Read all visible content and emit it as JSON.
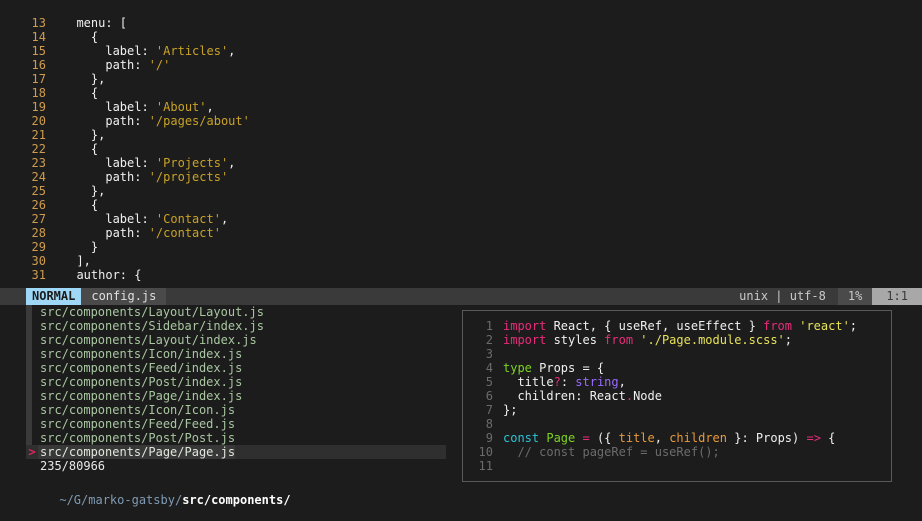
{
  "editor": {
    "lines": [
      {
        "num": "13",
        "segments": [
          {
            "t": "  menu: [",
            "c": "punc"
          }
        ]
      },
      {
        "num": "14",
        "segments": [
          {
            "t": "    {",
            "c": "punc"
          }
        ]
      },
      {
        "num": "15",
        "segments": [
          {
            "t": "      label: ",
            "c": "punc"
          },
          {
            "t": "'Articles'",
            "c": "str"
          },
          {
            "t": ",",
            "c": "punc"
          }
        ]
      },
      {
        "num": "16",
        "segments": [
          {
            "t": "      path: ",
            "c": "punc"
          },
          {
            "t": "'/'",
            "c": "str"
          }
        ]
      },
      {
        "num": "17",
        "segments": [
          {
            "t": "    },",
            "c": "punc"
          }
        ]
      },
      {
        "num": "18",
        "segments": [
          {
            "t": "    {",
            "c": "punc"
          }
        ]
      },
      {
        "num": "19",
        "segments": [
          {
            "t": "      label: ",
            "c": "punc"
          },
          {
            "t": "'About'",
            "c": "str"
          },
          {
            "t": ",",
            "c": "punc"
          }
        ]
      },
      {
        "num": "20",
        "segments": [
          {
            "t": "      path: ",
            "c": "punc"
          },
          {
            "t": "'/pages/about'",
            "c": "str"
          }
        ]
      },
      {
        "num": "21",
        "segments": [
          {
            "t": "    },",
            "c": "punc"
          }
        ]
      },
      {
        "num": "22",
        "segments": [
          {
            "t": "    {",
            "c": "punc"
          }
        ]
      },
      {
        "num": "23",
        "segments": [
          {
            "t": "      label: ",
            "c": "punc"
          },
          {
            "t": "'Projects'",
            "c": "str"
          },
          {
            "t": ",",
            "c": "punc"
          }
        ]
      },
      {
        "num": "24",
        "segments": [
          {
            "t": "      path: ",
            "c": "punc"
          },
          {
            "t": "'/projects'",
            "c": "str"
          }
        ]
      },
      {
        "num": "25",
        "segments": [
          {
            "t": "    },",
            "c": "punc"
          }
        ]
      },
      {
        "num": "26",
        "segments": [
          {
            "t": "    {",
            "c": "punc"
          }
        ]
      },
      {
        "num": "27",
        "segments": [
          {
            "t": "      label: ",
            "c": "punc"
          },
          {
            "t": "'Contact'",
            "c": "str"
          },
          {
            "t": ",",
            "c": "punc"
          }
        ]
      },
      {
        "num": "28",
        "segments": [
          {
            "t": "      path: ",
            "c": "punc"
          },
          {
            "t": "'/contact'",
            "c": "str"
          }
        ]
      },
      {
        "num": "29",
        "segments": [
          {
            "t": "    }",
            "c": "punc"
          }
        ]
      },
      {
        "num": "30",
        "segments": [
          {
            "t": "  ],",
            "c": "punc"
          }
        ]
      },
      {
        "num": "31",
        "segments": [
          {
            "t": "  author: {",
            "c": "punc"
          }
        ]
      }
    ]
  },
  "statusline": {
    "mode": "NORMAL",
    "filename": "config.js",
    "encoding": "unix | utf-8",
    "percent": "1%",
    "position": "1:1"
  },
  "filelist": {
    "items": [
      {
        "path": "src/components/Layout/Layout.js",
        "selected": false,
        "marker": ""
      },
      {
        "path": "src/components/Sidebar/index.js",
        "selected": false,
        "marker": ""
      },
      {
        "path": "src/components/Layout/index.js",
        "selected": false,
        "marker": ""
      },
      {
        "path": "src/components/Icon/index.js",
        "selected": false,
        "marker": ""
      },
      {
        "path": "src/components/Feed/index.js",
        "selected": false,
        "marker": ""
      },
      {
        "path": "src/components/Post/index.js",
        "selected": false,
        "marker": ""
      },
      {
        "path": "src/components/Page/index.js",
        "selected": false,
        "marker": ""
      },
      {
        "path": "src/components/Icon/Icon.js",
        "selected": false,
        "marker": ""
      },
      {
        "path": "src/components/Feed/Feed.js",
        "selected": false,
        "marker": ""
      },
      {
        "path": "src/components/Post/Post.js",
        "selected": false,
        "marker": ""
      },
      {
        "path": "src/components/Page/Page.js",
        "selected": true,
        "marker": ">"
      }
    ],
    "count": "235/80966"
  },
  "prompt": {
    "dim_path": "~/G/marko-gatsby/",
    "bold_path": "src/components/"
  },
  "preview": {
    "lines": [
      {
        "num": "1",
        "segments": [
          {
            "t": "import ",
            "c": "k-import"
          },
          {
            "t": "React, { useRef, useEffect } ",
            "c": "k-white"
          },
          {
            "t": "from ",
            "c": "k-import"
          },
          {
            "t": "'react'",
            "c": "k-str"
          },
          {
            "t": ";",
            "c": "k-white"
          }
        ]
      },
      {
        "num": "2",
        "segments": [
          {
            "t": "import ",
            "c": "k-import"
          },
          {
            "t": "styles ",
            "c": "k-white"
          },
          {
            "t": "from ",
            "c": "k-import"
          },
          {
            "t": "'./Page.module.scss'",
            "c": "k-str"
          },
          {
            "t": ";",
            "c": "k-white"
          }
        ]
      },
      {
        "num": "3",
        "segments": [
          {
            "t": "",
            "c": "k-white"
          }
        ]
      },
      {
        "num": "4",
        "segments": [
          {
            "t": "type ",
            "c": "k-type"
          },
          {
            "t": "Props = {",
            "c": "k-white"
          }
        ]
      },
      {
        "num": "5",
        "segments": [
          {
            "t": "  title",
            "c": "k-white"
          },
          {
            "t": "?",
            "c": "k-pink"
          },
          {
            "t": ": ",
            "c": "k-white"
          },
          {
            "t": "string",
            "c": "k-purple"
          },
          {
            "t": ",",
            "c": "k-white"
          }
        ]
      },
      {
        "num": "6",
        "segments": [
          {
            "t": "  children",
            "c": "k-white"
          },
          {
            "t": ": React",
            "c": "k-white"
          },
          {
            "t": ".",
            "c": "k-pink"
          },
          {
            "t": "Node",
            "c": "k-white"
          }
        ]
      },
      {
        "num": "7",
        "segments": [
          {
            "t": "};",
            "c": "k-white"
          }
        ]
      },
      {
        "num": "8",
        "segments": [
          {
            "t": "",
            "c": "k-white"
          }
        ]
      },
      {
        "num": "9",
        "segments": [
          {
            "t": "const ",
            "c": "k-const"
          },
          {
            "t": "Page ",
            "c": "k-green"
          },
          {
            "t": "= ",
            "c": "k-pink"
          },
          {
            "t": "({ ",
            "c": "k-white"
          },
          {
            "t": "title",
            "c": "k-orange"
          },
          {
            "t": ", ",
            "c": "k-white"
          },
          {
            "t": "children",
            "c": "k-orange"
          },
          {
            "t": " }: Props) ",
            "c": "k-white"
          },
          {
            "t": "=> ",
            "c": "k-pink"
          },
          {
            "t": "{",
            "c": "k-white"
          }
        ]
      },
      {
        "num": "10",
        "segments": [
          {
            "t": "  // const pageRef = useRef();",
            "c": "k-comment"
          }
        ]
      },
      {
        "num": "11",
        "segments": [
          {
            "t": "",
            "c": "k-white"
          }
        ]
      }
    ]
  }
}
